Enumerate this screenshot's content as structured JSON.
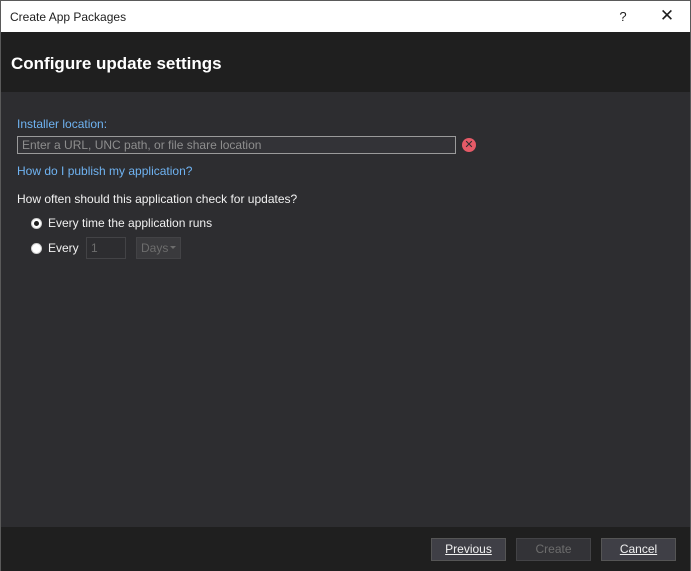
{
  "window": {
    "title": "Create App Packages",
    "help_label": "?",
    "close_label": "✕"
  },
  "header": {
    "heading": "Configure update settings"
  },
  "installer": {
    "label": "Installer location:",
    "placeholder": "Enter a URL, UNC path, or file share location",
    "value": "",
    "error_icon": "error-x-icon",
    "publish_link": "How do I publish my application?"
  },
  "update_check": {
    "question": "How often should this application check for updates?",
    "options": [
      {
        "label": "Every time the application runs",
        "selected": true
      },
      {
        "label": "Every",
        "selected": false
      }
    ],
    "interval_value": "1",
    "interval_unit": "Days"
  },
  "footer": {
    "previous_label": "Previous",
    "create_label": "Create",
    "cancel_label": "Cancel"
  },
  "colors": {
    "link": "#6fb3f2",
    "error": "#e55a67",
    "background": "#2d2d30",
    "header_background": "#1f1f1f"
  }
}
